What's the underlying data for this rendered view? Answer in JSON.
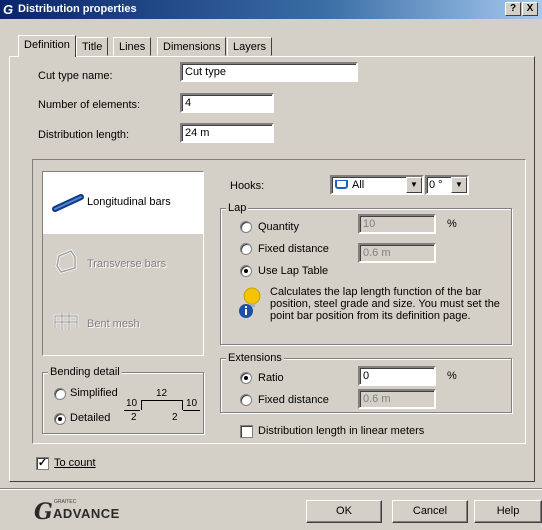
{
  "window": {
    "title": "Distribution properties",
    "help_button": "?",
    "close_button": "X"
  },
  "tabs": [
    "Definition",
    "Title",
    "Lines",
    "Dimensions",
    "Layers"
  ],
  "fields": {
    "cut_type_label": "Cut type name:",
    "cut_type_value": "Cut type",
    "elements_label": "Number of elements:",
    "elements_value": "4",
    "length_label": "Distribution length:",
    "length_value": "24 m"
  },
  "types": {
    "longitudinal": "Longitudinal bars",
    "transverse": "Transverse bars",
    "mesh": "Bent mesh"
  },
  "bending": {
    "title": "Bending detail",
    "simplified": "Simplified",
    "detailed": "Detailed",
    "selected": "detailed",
    "diagram": {
      "left_top": "10",
      "left_bottom": "2",
      "mid_top": "12",
      "mid_bottom": "2",
      "right_top": "10"
    }
  },
  "hooks": {
    "label": "Hooks:",
    "value": "All",
    "angle": "0 °"
  },
  "lap": {
    "title": "Lap",
    "quantity": "Quantity",
    "quantity_value": "10",
    "quantity_unit": "%",
    "fixed": "Fixed distance",
    "fixed_value": "0.6 m",
    "table": "Use Lap Table",
    "selected": "table",
    "info": "Calculates the lap length function of the bar position, steel grade and size. You must set the point bar position from its definition page."
  },
  "extensions": {
    "title": "Extensions",
    "ratio": "Ratio",
    "ratio_value": "0",
    "ratio_unit": "%",
    "fixed": "Fixed distance",
    "fixed_value": "0.6 m",
    "selected": "ratio"
  },
  "linear_meters": {
    "label": "Distribution length in linear meters",
    "checked": false
  },
  "to_count": {
    "label": "To count",
    "checked": true
  },
  "footer": {
    "brand_small": "GRAITEC",
    "brand": "ADVANCE",
    "ok": "OK",
    "cancel": "Cancel",
    "help": "Help"
  },
  "colors": {
    "title_bar": "#0a246a",
    "face": "#d4d0c8",
    "info_bulb": "#f5c400",
    "bar_blue": "#0d3d8a"
  }
}
